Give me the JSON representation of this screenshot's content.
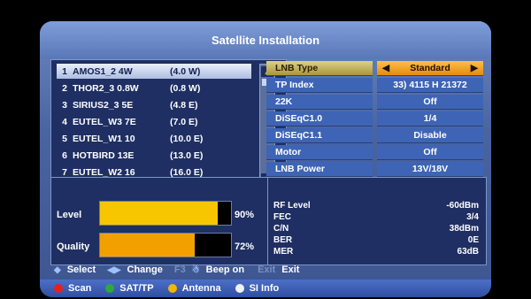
{
  "title": "Satellite Installation",
  "satellites": [
    {
      "num": "1",
      "name": "AMOS1_2 4W",
      "pos": "(4.0 W)"
    },
    {
      "num": "2",
      "name": "THOR2_3 0.8W",
      "pos": "(0.8 W)"
    },
    {
      "num": "3",
      "name": "SIRIUS2_3 5E",
      "pos": "(4.8 E)"
    },
    {
      "num": "4",
      "name": "EUTEL_W3 7E",
      "pos": "(7.0 E)"
    },
    {
      "num": "5",
      "name": "EUTEL_W1 10",
      "pos": "(10.0 E)"
    },
    {
      "num": "6",
      "name": "HOTBIRD 13E",
      "pos": "(13.0 E)"
    },
    {
      "num": "7",
      "name": "EUTEL_W2 16",
      "pos": "(16.0 E)"
    }
  ],
  "settings": [
    {
      "label": "LNB Type",
      "value": "Standard",
      "left_arrow": "◀",
      "right_arrow": "▶"
    },
    {
      "label": "TP Index",
      "value": "33) 4115 H 21372"
    },
    {
      "label": "22K",
      "value": "Off"
    },
    {
      "label": "DiSEqC1.0",
      "value": "1/4"
    },
    {
      "label": "DiSEqC1.1",
      "value": "Disable"
    },
    {
      "label": "Motor",
      "value": "Off"
    },
    {
      "label": "LNB Power",
      "value": "13V/18V"
    }
  ],
  "signal": {
    "level_label": "Level",
    "level_pct": "90%",
    "level_value": 0.9,
    "level_color": "#f7c600",
    "quality_label": "Quality",
    "quality_pct": "72%",
    "quality_value": 0.72,
    "quality_color": "#f2a000"
  },
  "readout": [
    {
      "label": "RF Level",
      "value": "-60dBm"
    },
    {
      "label": "FEC",
      "value": "3/4"
    },
    {
      "label": "C/N",
      "value": "38dBm"
    },
    {
      "label": "BER",
      "value": "0E"
    },
    {
      "label": "MER",
      "value": "63dB"
    }
  ],
  "help": {
    "select_icon": "◆",
    "select": "Select",
    "change_icon": "◀▶",
    "change": "Change",
    "f3": "F3",
    "beep_icon": "speaker-icon",
    "beep": "Beep on",
    "exit_key": "Exit",
    "exit": "Exit"
  },
  "color_keys": [
    {
      "label": "Scan",
      "color": "#e8201c"
    },
    {
      "label": "SAT/TP",
      "color": "#2fa83a"
    },
    {
      "label": "Antenna",
      "color": "#f0b800"
    },
    {
      "label": "SI Info",
      "color": "#f2f2f2"
    }
  ]
}
